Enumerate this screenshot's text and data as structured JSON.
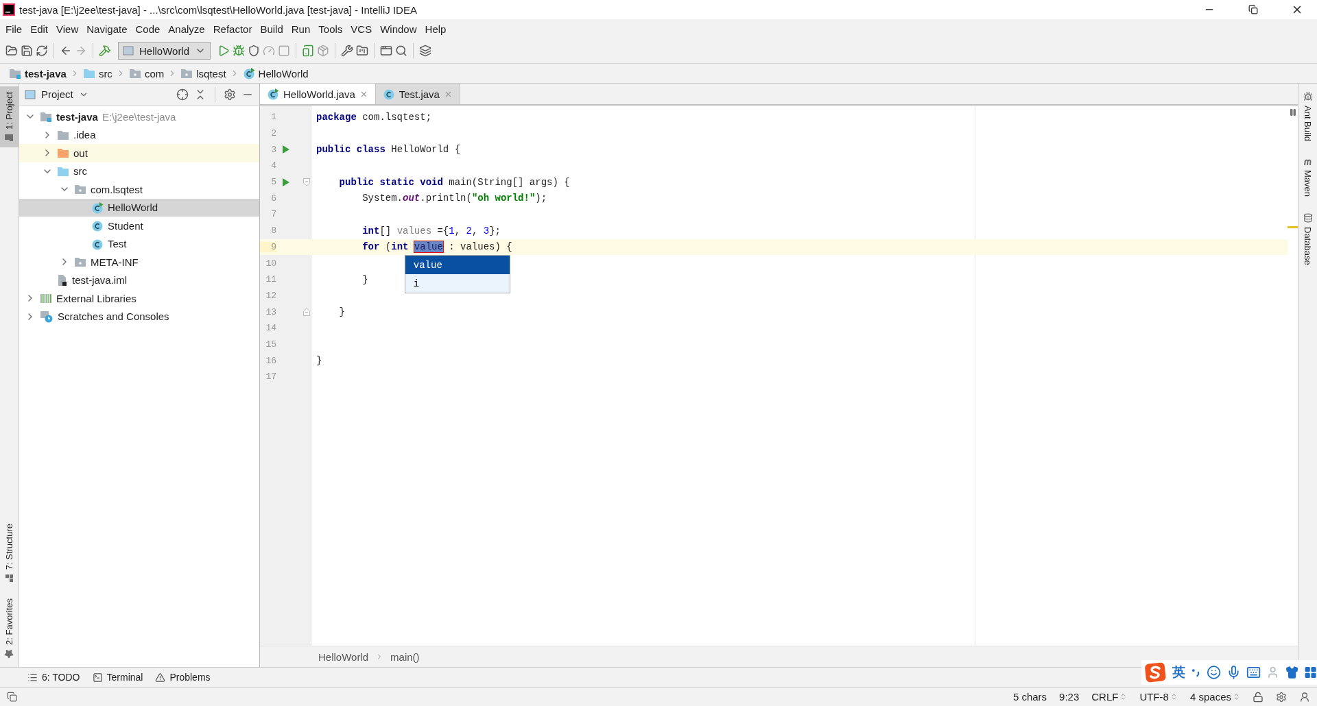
{
  "window": {
    "title": "test-java [E:\\j2ee\\test-java] - ...\\src\\com\\lsqtest\\HelloWorld.java [test-java] - IntelliJ IDEA"
  },
  "menu": [
    "File",
    "Edit",
    "View",
    "Navigate",
    "Code",
    "Analyze",
    "Refactor",
    "Build",
    "Run",
    "Tools",
    "VCS",
    "Window",
    "Help"
  ],
  "toolbar": {
    "run_config": "HelloWorld"
  },
  "breadcrumbs": [
    {
      "label": "test-java",
      "kind": "project"
    },
    {
      "label": "src",
      "kind": "source_folder"
    },
    {
      "label": "com",
      "kind": "package"
    },
    {
      "label": "lsqtest",
      "kind": "package"
    },
    {
      "label": "HelloWorld",
      "kind": "class_main"
    }
  ],
  "left_stripe": {
    "top": [
      {
        "label": "1: Project",
        "kind": "project",
        "selected": true
      }
    ],
    "bottom": [
      {
        "label": "7: Structure",
        "kind": "structure",
        "selected": false
      },
      {
        "label": "2: Favorites",
        "kind": "favorites",
        "selected": false
      }
    ]
  },
  "project_panel": {
    "title": "Project",
    "tree": [
      {
        "label": "test-java",
        "hint": "E:\\j2ee\\test-java",
        "kind": "project",
        "expanded": true,
        "selected": false,
        "highlighted": false,
        "children": [
          {
            "label": ".idea",
            "kind": "folder",
            "expanded": false,
            "selected": false,
            "highlighted": false
          },
          {
            "label": "out",
            "kind": "excluded_folder",
            "expanded": false,
            "selected": false,
            "highlighted": true
          },
          {
            "label": "src",
            "kind": "source_folder",
            "expanded": true,
            "selected": false,
            "highlighted": false,
            "children": [
              {
                "label": "com.lsqtest",
                "kind": "package",
                "expanded": true,
                "selected": false,
                "highlighted": false,
                "children": [
                  {
                    "label": "HelloWorld",
                    "kind": "class_main",
                    "selected": true,
                    "highlighted": false
                  },
                  {
                    "label": "Student",
                    "kind": "class",
                    "selected": false,
                    "highlighted": false
                  },
                  {
                    "label": "Test",
                    "kind": "class",
                    "selected": false,
                    "highlighted": false
                  }
                ]
              },
              {
                "label": "META-INF",
                "kind": "package",
                "expanded": false,
                "selected": false,
                "highlighted": false
              }
            ]
          },
          {
            "label": "test-java.iml",
            "kind": "module_file",
            "selected": false,
            "highlighted": false
          }
        ]
      },
      {
        "label": "External Libraries",
        "kind": "libraries",
        "expanded": false,
        "selected": false,
        "highlighted": false
      },
      {
        "label": "Scratches and Consoles",
        "kind": "scratches",
        "expanded": false,
        "selected": false,
        "highlighted": false
      }
    ]
  },
  "editor": {
    "tabs": [
      {
        "label": "HelloWorld.java",
        "kind": "class_main",
        "selected": true
      },
      {
        "label": "Test.java",
        "kind": "class",
        "selected": false
      }
    ],
    "lines": [
      {
        "number": "1",
        "current": false,
        "tokens": [
          {
            "kind": "keyword",
            "text": "package"
          },
          {
            "kind": "plain",
            "text": " com.lsqtest;"
          }
        ]
      },
      {
        "number": "2",
        "current": false
      },
      {
        "number": "3",
        "run_marker": true,
        "current": false,
        "tokens": [
          {
            "kind": "keyword",
            "text": "public class"
          },
          {
            "kind": "plain",
            "text": " HelloWorld {"
          }
        ]
      },
      {
        "number": "4",
        "current": false
      },
      {
        "number": "5",
        "run_marker": true,
        "fold_start": true,
        "current": false,
        "tokens": [
          {
            "kind": "keyword",
            "text": "    public static void"
          },
          {
            "kind": "plain",
            "text": " main(String[] args) {"
          }
        ]
      },
      {
        "number": "6",
        "current": false,
        "tokens": [
          {
            "kind": "plain",
            "text": "        System."
          },
          {
            "kind": "field",
            "text": "out"
          },
          {
            "kind": "plain",
            "text": ".println("
          },
          {
            "kind": "string",
            "text": "\"oh world!\""
          },
          {
            "kind": "plain",
            "text": ");"
          }
        ]
      },
      {
        "number": "7",
        "current": false
      },
      {
        "number": "8",
        "current": false,
        "tokens": [
          {
            "kind": "keyword",
            "text": "        int"
          },
          {
            "kind": "plain",
            "text": "[] "
          },
          {
            "kind": "unused",
            "text": "values"
          },
          {
            "kind": "plain",
            "text": " ={"
          },
          {
            "kind": "number",
            "text": "1"
          },
          {
            "kind": "plain",
            "text": ", "
          },
          {
            "kind": "number",
            "text": "2"
          },
          {
            "kind": "plain",
            "text": ", "
          },
          {
            "kind": "number",
            "text": "3"
          },
          {
            "kind": "plain",
            "text": "};"
          }
        ]
      },
      {
        "number": "9",
        "current": true,
        "tokens": [
          {
            "kind": "keyword",
            "text": "        for"
          },
          {
            "kind": "plain",
            "text": " ("
          },
          {
            "kind": "keyword",
            "text": "int "
          },
          {
            "kind": "template",
            "text": "value"
          },
          {
            "kind": "plain",
            "text": " : values) {"
          }
        ]
      },
      {
        "number": "10",
        "current": false
      },
      {
        "number": "11",
        "current": false,
        "tokens": [
          {
            "kind": "plain",
            "text": "        }"
          }
        ]
      },
      {
        "number": "12",
        "current": false
      },
      {
        "number": "13",
        "fold_end": true,
        "current": false,
        "tokens": [
          {
            "kind": "plain",
            "text": "    }"
          }
        ]
      },
      {
        "number": "14",
        "current": false
      },
      {
        "number": "15",
        "current": false
      },
      {
        "number": "16",
        "current": false,
        "tokens": [
          {
            "kind": "plain",
            "text": "}"
          }
        ]
      },
      {
        "number": "17",
        "current": false
      }
    ],
    "completion": {
      "items": [
        {
          "label": "value",
          "selected": true
        },
        {
          "label": "i",
          "selected": false
        }
      ]
    },
    "breadcrumbs": [
      "HelloWorld",
      "main()"
    ]
  },
  "right_stripe": [
    {
      "label": "Ant Build",
      "kind": "ant"
    },
    {
      "label": "Maven",
      "kind": "maven"
    },
    {
      "label": "Database",
      "kind": "database"
    }
  ],
  "bottom_tabs": [
    {
      "label": "6: TODO",
      "kind": "todo"
    },
    {
      "label": "Terminal",
      "kind": "terminal"
    },
    {
      "label": "Problems",
      "kind": "problems"
    }
  ],
  "status_bar": [
    {
      "text": "5 chars",
      "dropdown": false
    },
    {
      "text": "9:23",
      "dropdown": false
    },
    {
      "text": "CRLF",
      "dropdown": true
    },
    {
      "text": "UTF-8",
      "dropdown": true
    },
    {
      "text": "4 spaces",
      "dropdown": true
    }
  ],
  "ime": {
    "label": "英"
  }
}
